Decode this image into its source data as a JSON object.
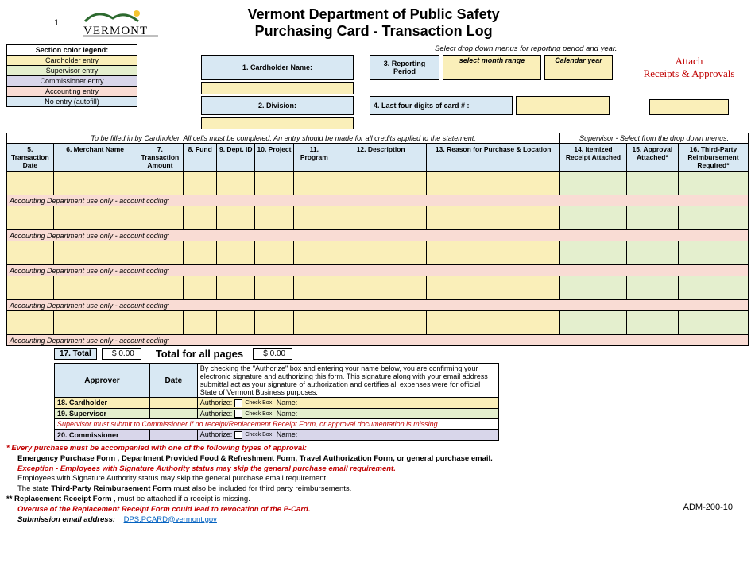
{
  "page_number": "1",
  "title_line1": "Vermont Department of Public Safety",
  "title_line2": "Purchasing Card - Transaction Log",
  "logo_text": "VERMONT",
  "legend": {
    "header": "Section color legend:",
    "items": [
      "Cardholder entry",
      "Supervisor entry",
      "Commissioner entry",
      "Accounting entry",
      "No entry (autofill)"
    ]
  },
  "info_note": "Select drop down menus for reporting period and year.",
  "fields": {
    "cardholder_name_lbl": "1. Cardholder Name:",
    "cardholder_name_val": "",
    "division_lbl": "2. Division:",
    "division_val": "",
    "reporting_period_lbl": "3. Reporting Period",
    "reporting_period_month": "select month range",
    "reporting_period_year": "Calendar year",
    "last4_lbl": "4. Last four digits of card # :",
    "last4_val": ""
  },
  "attach": {
    "line1": "Attach",
    "line2": "Receipts & Approvals"
  },
  "table": {
    "note_left": "To be filled in by Cardholder. All cells must be completed. An entry should be made for all credits applied to the statement.",
    "note_right": "Supervisor  - Select from the drop down menus.",
    "headers": [
      "5. Transaction Date",
      "6. Merchant Name",
      "7. Transaction Amount",
      "8. Fund",
      "9. Dept. ID",
      "10. Project",
      "11. Program",
      "12. Description",
      "13. Reason for Purchase & Location",
      "14. Itemized Receipt Attached",
      "15. Approval Attached*",
      "16. Third-Party Reimbursement Required*"
    ],
    "acct_label": "Accounting Department use only - account coding:",
    "row_count": 5
  },
  "totals": {
    "lbl17": "17. Total",
    "val17": "$ 0.00",
    "lbl_all": "Total for all pages",
    "val_all": "$ 0.00"
  },
  "approver": {
    "col_approver": "Approver",
    "col_date": "Date",
    "auth_note": "By checking the \"Authorize\" box and entering your name below, you are confirming your electronic signature and authorizing this form. This signature along with your email address submittal act as your signature of authorization and certifies all expenses were for official State of Vermont Business purposes.",
    "rows": [
      {
        "label": "18. Cardholder"
      },
      {
        "label": "19. Supervisor"
      }
    ],
    "warn": "Supervisor must submit to Commissioner if no receipt/Replacement Receipt Form, or approval documentation is missing.",
    "row20": "20. Commissioner",
    "authorize": "Authorize:",
    "checkbox": "Check Box",
    "name": "Name:"
  },
  "footnotes": {
    "f1_prefix": "*  ",
    "f1": "Every purchase must be accompanied with one of the following types of approval:",
    "f2_list": "Emergency Purchase Form ,  Department Provided Food & Refreshment Form, Travel Authorization Form,  or  general purchase email.",
    "f3_prefix": "Exception  - ",
    "f3": "Employees with Signature Authority status may skip the general purchase email requirement.",
    "f4": "Employees with Signature Authority status may skip the general purchase email requirement.",
    "f5_pre": "The state ",
    "f5_bold": "Third-Party Reimbursement Form",
    "f5_post": "  must also be included for third party reimbursements.",
    "f6_pre": "** ",
    "f6_bold": "Replacement Receipt Form ",
    "f6_post": ", must be attached if a receipt is missing.",
    "f7": "Overuse of the Replacement Receipt Form could lead to revocation of the P-Card.",
    "f8_lbl": "Submission email address:",
    "f8_link": "DPS.PCARD@vermont.gov"
  },
  "form_id": "ADM-200-10"
}
